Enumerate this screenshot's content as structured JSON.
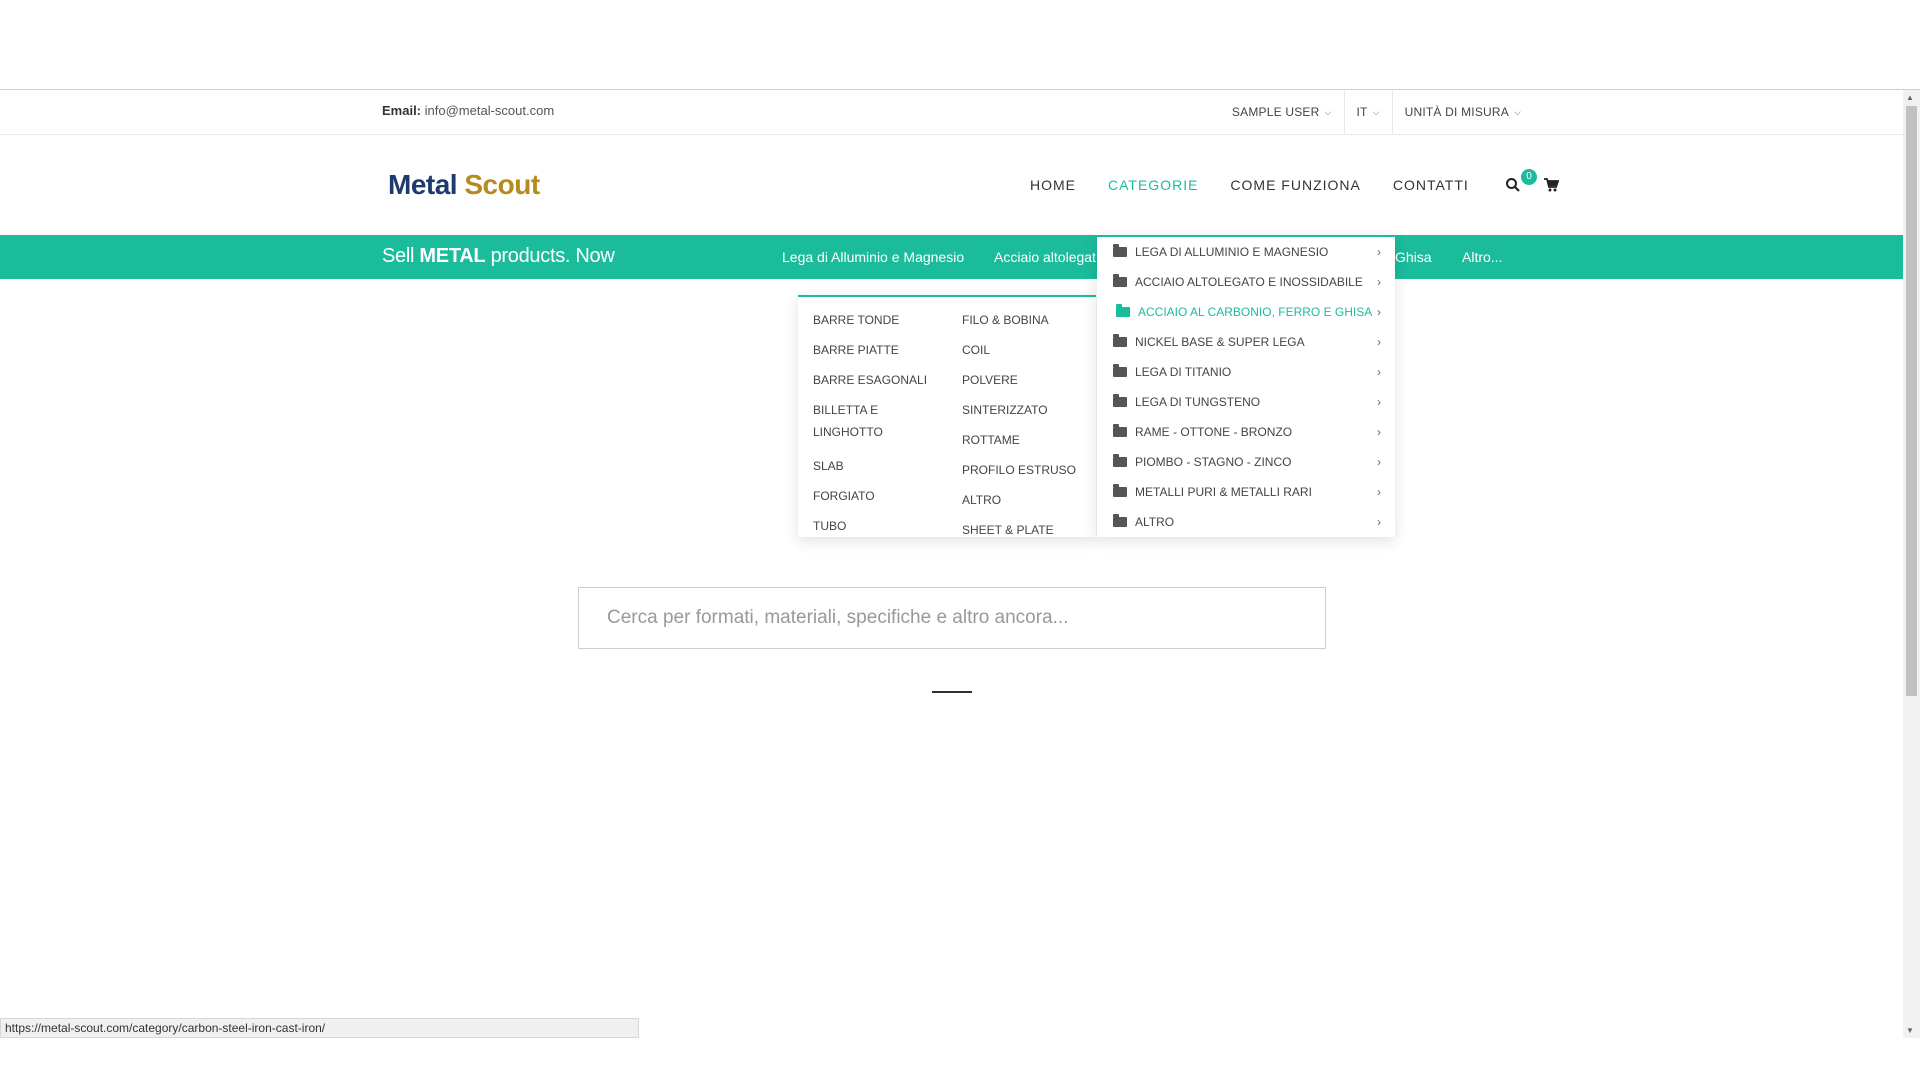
{
  "topbar": {
    "email_label": "Email:",
    "email_value": "info@metal-scout.com",
    "user": "SAMPLE USER",
    "lang": "IT",
    "units": "UNITÀ DI MISURA"
  },
  "logo": {
    "part1": "Metal",
    "part2": "Scout"
  },
  "mainnav": {
    "items": [
      "HOME",
      "CATEGORIE",
      "COME FUNZIONA",
      "CONTATTI"
    ],
    "active": "CATEGORIE",
    "cart_count": "0"
  },
  "greenbar": {
    "tagline_pre": "Sell",
    "tagline_bold": "METAL",
    "tagline_post": "products. Now",
    "catnav": [
      "Lega di Alluminio e Magnesio",
      "Acciaio altolegat",
      "Ghisa",
      "Altro..."
    ]
  },
  "megamenu": {
    "col1": [
      "BARRE TONDE",
      "BARRE PIATTE",
      "BARRE ESAGONALI",
      "BILLETTA E LINGHOTTO",
      "SLAB",
      "FORGIATO",
      "TUBO"
    ],
    "col2": [
      "FILO & BOBINA",
      "COIL",
      "POLVERE",
      "SINTERIZZATO",
      "ROTTAME",
      "PROFILO ESTRUSO",
      "ALTRO",
      "SHEET & PLATE"
    ]
  },
  "dropdown": {
    "items": [
      "LEGA DI ALLUMINIO E MAGNESIO",
      "ACCIAIO ALTOLEGATO E INOSSIDABILE",
      "ACCIAIO AL CARBONIO, FERRO E GHISA",
      "NICKEL BASE & SUPER LEGA",
      "LEGA DI TITANIO",
      "LEGA DI TUNGSTENO",
      "RAME - OTTONE - BRONZO",
      "PIOMBO - STAGNO - ZINCO",
      "METALLI PURI & METALLI RARI",
      "ALTRO"
    ],
    "active_index": 2
  },
  "search": {
    "placeholder": "Cerca per formati, materiali, specifiche e altro ancora..."
  },
  "statusbar": {
    "url": "https://metal-scout.com/category/carbon-steel-iron-cast-iron/"
  },
  "colors": {
    "accent": "#1abc9c",
    "logo_blue": "#1f3a6e",
    "logo_gold": "#b58b1e"
  }
}
